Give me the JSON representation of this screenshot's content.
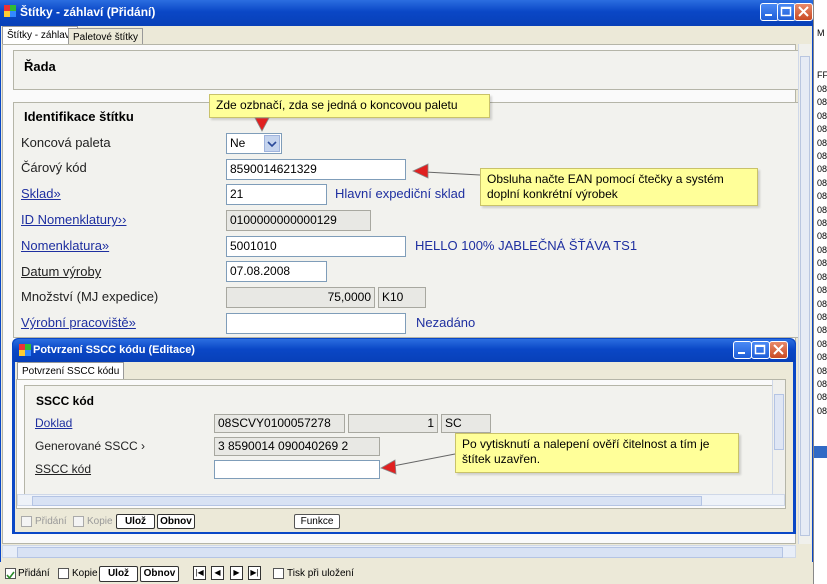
{
  "main_window": {
    "title": "Štítky - záhlaví (Přidání)",
    "tabs": [
      "Štítky - záhlaví",
      "Paletové štítky"
    ],
    "section_rada": "Řada",
    "section_ident": "Identifikace štítku",
    "fields": {
      "koncova_paleta": {
        "label": "Koncová paleta",
        "value": "Ne"
      },
      "carovy_kod": {
        "label": "Čárový kód",
        "value": "8590014621329"
      },
      "sklad": {
        "label": "Sklad»",
        "value": "21",
        "desc": "Hlavní expediční sklad"
      },
      "id_nomenklatury": {
        "label": "ID Nomenklatury››",
        "value": "0100000000000129"
      },
      "nomenklatura": {
        "label": "Nomenklatura»",
        "value": "5001010",
        "desc": "HELLO 100% JABLEČNÁ ŠŤÁVA   TS1"
      },
      "datum_vyroby": {
        "label": "Datum výroby",
        "value": "07.08.2008"
      },
      "mnozstvi": {
        "label": "Množství (MJ expedice)",
        "value": "75,0000",
        "unit": "K10"
      },
      "vyrobni_pracoviste": {
        "label": "Výrobní pracoviště»",
        "value": "",
        "desc": "Nezadáno"
      }
    },
    "notes": {
      "paleta": "Zde ozbnačí, zda se jedná o koncovou paletu",
      "ean": "Obsluha načte EAN pomocí čtečky a systém doplní konkrétní výrobek"
    },
    "bottom_bar": {
      "pridani": "Přidání",
      "kopie": "Kopie",
      "uloz": "Ulož",
      "obnov": "Obnov",
      "nav": [
        "|◀",
        "◀",
        "▶",
        "▶|"
      ],
      "tisk": "Tisk při uložení"
    }
  },
  "dialog": {
    "title": "Potvrzení SSCC kódu (Editace)",
    "tab": "Potvrzení SSCC kódu",
    "section": "SSCC kód",
    "doklad": {
      "label": "Doklad",
      "value": "08SCVY0100057278",
      "num": "1",
      "code": "SC"
    },
    "generovane": {
      "label": "Generované SSCC ›",
      "value": "3 8590014 090040269 2"
    },
    "sscc": {
      "label": "SSCC kód",
      "value": ""
    },
    "note": "Po vytisknutí a nalepení ověří čitelnost a tím je štítek uzavřen.",
    "buttons": {
      "pridani": "Přidání",
      "kopie": "Kopie",
      "uloz": "Ulož",
      "obnov": "Obnov",
      "funkce": "Funkce"
    }
  },
  "right_strip": {
    "top": "M",
    "header": "FF",
    "rows": [
      "08",
      "08",
      "08",
      "08",
      "08",
      "08",
      "08",
      "08",
      "08",
      "08",
      "08",
      "08",
      "08",
      "08",
      "08",
      "08",
      "08",
      "08",
      "08",
      "08",
      "08",
      "08",
      "08",
      "08",
      "08"
    ]
  }
}
